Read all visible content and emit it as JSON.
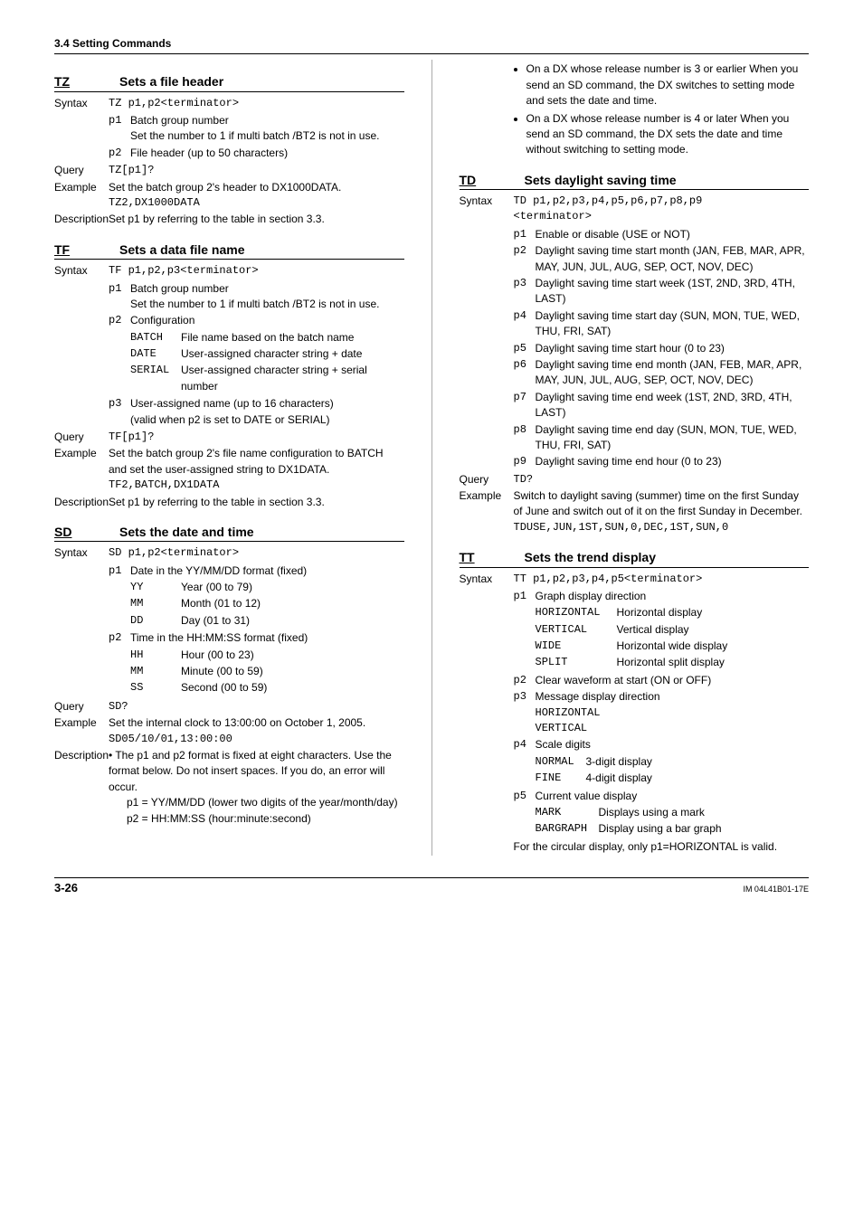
{
  "sectionHeader": "3.4  Setting Commands",
  "left": {
    "TZ": {
      "code": "TZ",
      "name": "Sets a file header",
      "syntaxLabel": "Syntax",
      "syntax": "TZ p1,p2<terminator>",
      "p1": {
        "k": "p1",
        "l1": "Batch group number",
        "l2": "Set the number to 1 if multi batch /BT2 is not in use."
      },
      "p2": {
        "k": "p2",
        "v": "File header (up to 50 characters)"
      },
      "queryLabel": "Query",
      "query": "TZ[p1]?",
      "exampleLabel": "Example",
      "exampleText": "Set the batch group 2's header to DX1000DATA.",
      "exampleCode": "TZ2,DX1000DATA",
      "descLabel": "Description",
      "desc": "Set p1 by referring to the table in section 3.3."
    },
    "TF": {
      "code": "TF",
      "name": "Sets a data file name",
      "syntaxLabel": "Syntax",
      "syntax": "TF p1,p2,p3<terminator>",
      "p1": {
        "k": "p1",
        "l1": "Batch group number",
        "l2": "Set the number to 1 if multi batch /BT2 is not in use."
      },
      "p2": {
        "k": "p2",
        "head": "Configuration",
        "opts": [
          {
            "k": "BATCH",
            "v": "File name based on the batch name"
          },
          {
            "k": "DATE",
            "v": "User-assigned character string + date"
          },
          {
            "k": "SERIAL",
            "v": "User-assigned character string + serial number"
          }
        ]
      },
      "p3": {
        "k": "p3",
        "l1": "User-assigned name (up to 16 characters)",
        "l2": "(valid when p2 is set to DATE or SERIAL)"
      },
      "queryLabel": "Query",
      "query": "TF[p1]?",
      "exampleLabel": "Example",
      "exampleText": "Set the batch group 2's file name configuration to BATCH and set the user-assigned string to DX1DATA.",
      "exampleCode": "TF2,BATCH,DX1DATA",
      "descLabel": "Description",
      "desc": "Set p1 by referring to the table in section 3.3."
    },
    "SD": {
      "code": "SD",
      "name": "Sets the date and time",
      "syntaxLabel": "Syntax",
      "syntax": "SD p1,p2<terminator>",
      "p1": {
        "k": "p1",
        "head": "Date in the YY/MM/DD format (fixed)",
        "opts": [
          {
            "k": "YY",
            "v": "Year (00 to 79)"
          },
          {
            "k": "MM",
            "v": "Month (01 to 12)"
          },
          {
            "k": "DD",
            "v": "Day (01 to 31)"
          }
        ]
      },
      "p2": {
        "k": "p2",
        "head": "Time in the HH:MM:SS format (fixed)",
        "opts": [
          {
            "k": "HH",
            "v": "Hour (00 to 23)"
          },
          {
            "k": "MM",
            "v": "Minute (00 to 59)"
          },
          {
            "k": "SS",
            "v": "Second (00 to 59)"
          }
        ]
      },
      "queryLabel": "Query",
      "query": "SD?",
      "exampleLabel": "Example",
      "exampleText": "Set the internal clock to 13:00:00 on October 1, 2005.",
      "exampleCode": "SD05/10/01,13:00:00",
      "descLabel": "Description",
      "descBullets": [
        "The p1 and p2 format is fixed at eight characters. Use the format below. Do not insert spaces. If you do, an error will occur.",
        "p1 = YY/MM/DD (lower two digits of the year/month/day)",
        "p2 = HH:MM:SS (hour:minute:second)"
      ]
    }
  },
  "right": {
    "topBullets": [
      "On a DX whose release number is 3 or earlier When you send an SD command, the DX switches to setting mode and sets the date and time.",
      "On a DX whose release number is 4 or later When you send an SD command, the DX sets the date and time without switching to setting mode."
    ],
    "TD": {
      "code": "TD",
      "name": "Sets daylight saving time",
      "syntaxLabel": "Syntax",
      "syntax1": "TD p1,p2,p3,p4,p5,p6,p7,p8,p9",
      "syntax2": "<terminator>",
      "params": [
        {
          "k": "p1",
          "v": "Enable or disable (USE or NOT)"
        },
        {
          "k": "p2",
          "v": "Daylight saving time start month (JAN, FEB, MAR, APR, MAY, JUN, JUL, AUG, SEP, OCT, NOV, DEC)"
        },
        {
          "k": "p3",
          "v": "Daylight saving time start week (1ST, 2ND, 3RD, 4TH, LAST)"
        },
        {
          "k": "p4",
          "v": "Daylight saving time start day (SUN, MON, TUE, WED, THU, FRI, SAT)"
        },
        {
          "k": "p5",
          "v": "Daylight saving time start hour (0 to 23)"
        },
        {
          "k": "p6",
          "v": "Daylight saving time end month (JAN, FEB, MAR, APR, MAY, JUN, JUL, AUG, SEP, OCT, NOV, DEC)"
        },
        {
          "k": "p7",
          "v": "Daylight saving time end week (1ST, 2ND, 3RD, 4TH, LAST)"
        },
        {
          "k": "p8",
          "v": "Daylight saving time end day (SUN, MON, TUE, WED, THU, FRI, SAT)"
        },
        {
          "k": "p9",
          "v": "Daylight saving time end hour (0 to 23)"
        }
      ],
      "queryLabel": "Query",
      "query": "TD?",
      "exampleLabel": "Example",
      "exampleText": "Switch to daylight saving (summer) time on the first Sunday of June and switch out of it on the first Sunday in December.",
      "exampleCode": "TDUSE,JUN,1ST,SUN,0,DEC,1ST,SUN,0"
    },
    "TT": {
      "code": "TT",
      "name": "Sets the trend display",
      "syntaxLabel": "Syntax",
      "syntax": "TT p1,p2,p3,p4,p5<terminator>",
      "p1": {
        "k": "p1",
        "head": "Graph display direction",
        "opts": [
          {
            "k": "HORIZONTAL",
            "v": "Horizontal display"
          },
          {
            "k": "VERTICAL",
            "v": "Vertical display"
          },
          {
            "k": "WIDE",
            "v": "Horizontal wide display"
          },
          {
            "k": "SPLIT",
            "v": "Horizontal split display"
          }
        ]
      },
      "p2": {
        "k": "p2",
        "v": "Clear waveform at start (ON or OFF)"
      },
      "p3": {
        "k": "p3",
        "head": "Message display direction",
        "opts": [
          {
            "k": "HORIZONTAL"
          },
          {
            "k": "VERTICAL"
          }
        ]
      },
      "p4": {
        "k": "p4",
        "head": "Scale digits",
        "opts": [
          {
            "k": "NORMAL",
            "v": "3-digit display"
          },
          {
            "k": "FINE",
            "v": "4-digit display"
          }
        ]
      },
      "p5": {
        "k": "p5",
        "head": "Current value display",
        "opts": [
          {
            "k": "MARK",
            "v": "Displays using a mark"
          },
          {
            "k": "BARGRAPH",
            "v": "Display using a bar graph"
          }
        ]
      },
      "note": "For the circular display, only p1=HORIZONTAL is valid."
    }
  },
  "footer": {
    "page": "3-26",
    "doc": "IM 04L41B01-17E"
  }
}
